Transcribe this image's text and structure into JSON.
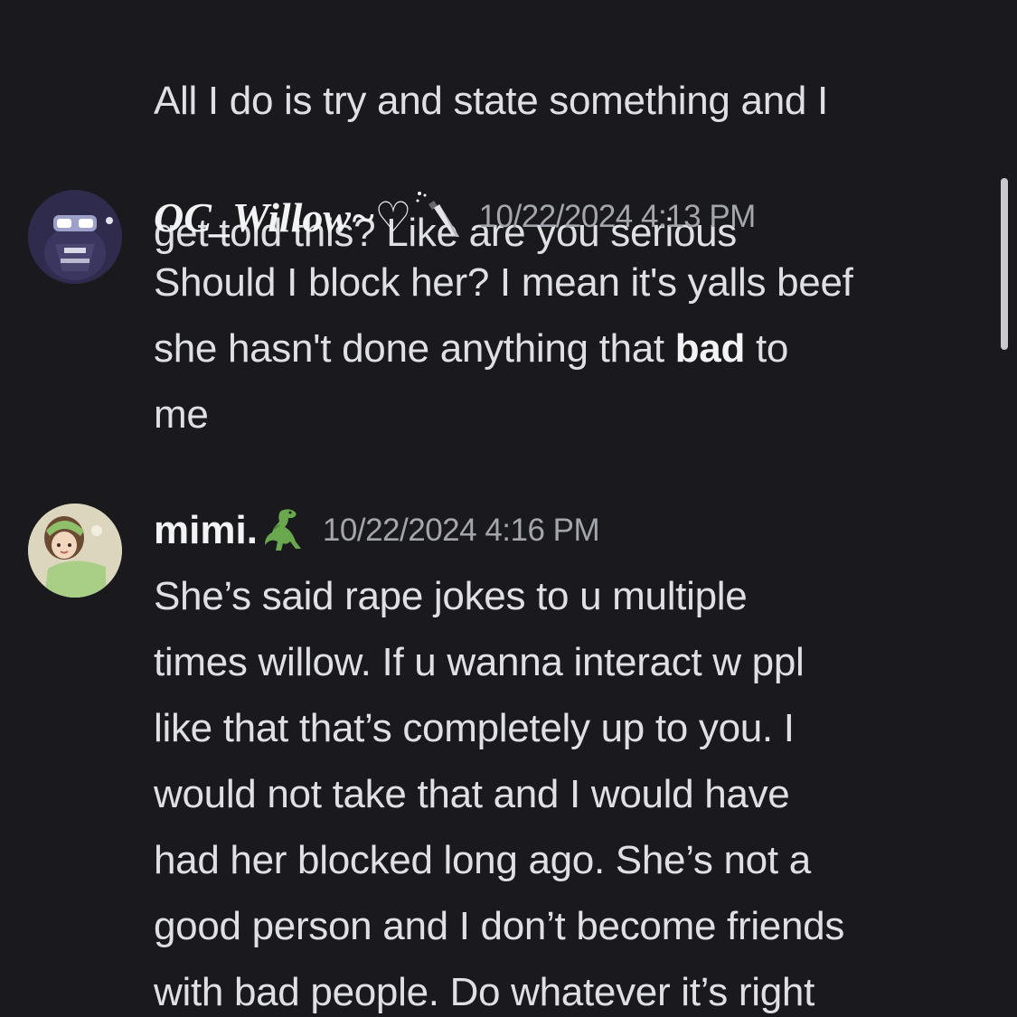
{
  "messages": [
    {
      "text_lines": [
        "All I do is try and state something and I",
        "get told this? Like are you serious"
      ]
    },
    {
      "author": "OC_Willow~♡",
      "badge_icon": "knife-icon",
      "timestamp": "10/22/2024 4:13 PM",
      "text_before_bold": "Should I block her? I mean it's yalls beef\nshe hasn't done anything that ",
      "text_bold": "bad",
      "text_after_bold": " to\nme"
    },
    {
      "author": "mimi.",
      "badge_icon": "dinosaur-icon",
      "timestamp": "10/22/2024 4:16 PM",
      "text": "She’s said rape jokes to u multiple\ntimes willow. If u wanna interact w ppl\nlike that that’s completely up to you. I\nwould not take that and I would have\nhad her blocked long ago. She’s not a\ngood person and I don’t become friends\nwith bad people. Do whatever it’s right"
    }
  ],
  "colors": {
    "background": "#1a1a1e",
    "text": "#dfe0e4",
    "username": "#f2f3f5",
    "timestamp": "#a3a6ad"
  }
}
